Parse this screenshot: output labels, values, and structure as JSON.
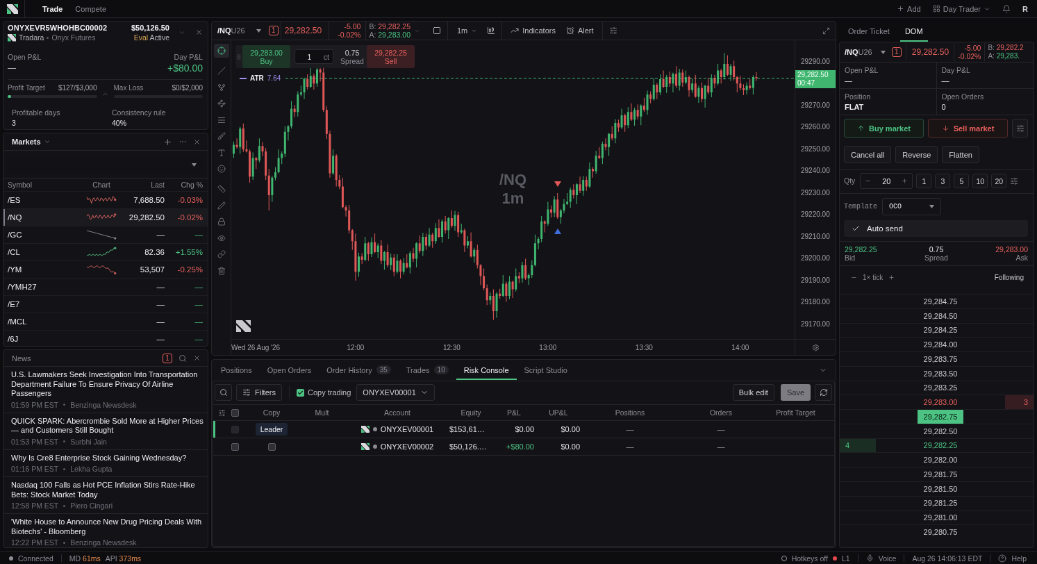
{
  "top_bar": {
    "nav_tabs": [
      {
        "label": "Trade",
        "selected": true
      },
      {
        "label": "Compete",
        "selected": false
      }
    ],
    "add_label": "Add",
    "layout_label": "Day Trader",
    "avatar": "R"
  },
  "account": {
    "id": "ONYXEVR5WHOHBC00002",
    "firm": "Tradara",
    "provider": "Onyx Futures",
    "balance": "$50,126.50",
    "stage": "Eval",
    "status": "Active",
    "open_pnl": {
      "label": "Open P&L",
      "value": "—"
    },
    "day_pnl": {
      "label": "Day P&L",
      "value": "+$80.00",
      "gain": true
    },
    "rules": [
      {
        "label": "Profit Target",
        "value": "$127/$3,000",
        "level": 0.04
      },
      {
        "label": "Max Loss",
        "value": "$0/$2,000"
      }
    ],
    "stats": [
      {
        "label": "Profitable days",
        "value": "3"
      },
      {
        "label": "Consistency rule",
        "value": "40%"
      }
    ]
  },
  "markets": {
    "title": "Markets",
    "columns": [
      "Symbol",
      "Chart",
      "Last",
      "Chg %"
    ],
    "rows": [
      {
        "symbol": "/ES",
        "kind": "choppy",
        "last": "7,688.50",
        "change": "-0.03%",
        "negative": true,
        "selected": false
      },
      {
        "symbol": "/NQ",
        "kind": "choppy",
        "last": "29,282.50",
        "change": "-0.02%",
        "negative": true,
        "selected": true
      },
      {
        "symbol": "/GC",
        "kind": "line",
        "last": "—",
        "change": "—",
        "negative": false,
        "selected": false
      },
      {
        "symbol": "/CL",
        "kind": "rising",
        "last": "82.36",
        "change": "+1.55%",
        "negative": false,
        "selected": false
      },
      {
        "symbol": "/YM",
        "kind": "dropping",
        "last": "53,507",
        "change": "-0.25%",
        "negative": true,
        "selected": false
      },
      {
        "symbol": "/YMH27",
        "kind": "plain",
        "last": "—",
        "change": "—",
        "negative": false,
        "selected": false
      },
      {
        "symbol": "/E7",
        "kind": "plain",
        "last": "—",
        "change": "—",
        "negative": false,
        "selected": false
      },
      {
        "symbol": "/MCL",
        "kind": "plain",
        "last": "—",
        "change": "—",
        "negative": false,
        "selected": false
      },
      {
        "symbol": "/6J",
        "kind": "plain",
        "last": "—",
        "change": "—",
        "negative": false,
        "selected": false
      }
    ]
  },
  "news": {
    "title": "News",
    "badge": "1",
    "items": [
      {
        "headline": "U.S. Lawmakers Seek Investigation Into Transportation Department Failure To Ensure Privacy Of Airline Passengers",
        "time": "01:59 PM EST",
        "source": "Benzinga Newsdesk"
      },
      {
        "headline": "QUICK SPARK: Abercrombie Sold More at Higher Prices — and Customers Still Bought",
        "time": "01:53 PM EST",
        "source": "Surbhi Jain"
      },
      {
        "headline": "Why Is Cre8 Enterprise Stock Gaining Wednesday?",
        "time": "01:16 PM EST",
        "source": "Lekha Gupta"
      },
      {
        "headline": "Nasdaq 100 Falls as Hot PCE Inflation Stirs Rate-Hike Bets: Stock Market Today",
        "time": "12:58 PM EST",
        "source": "Piero Cingari"
      },
      {
        "headline": "'White House to Announce New Drug Pricing Deals With Biotechs' - Bloomberg",
        "time": "12:22 PM EST",
        "source": "Benzinga Newsdesk"
      }
    ]
  },
  "chart": {
    "symbol": "/NQ",
    "contract": "U26",
    "position_badge": "1",
    "price": "29,282.50",
    "change": "-5.00",
    "change_pct": "-0.02%",
    "negative": true,
    "bid_label": "B:",
    "bid": "29,282.25",
    "ask_label": "A:",
    "ask": "29,283.00",
    "interval": "1m",
    "indicators_label": "Indicators",
    "alert_label": "Alert",
    "drawing_tools": [
      [
        {
          "kind": "crosshair",
          "selected": true
        }
      ],
      [
        {
          "kind": "line",
          "selected": false
        },
        {
          "kind": "fork",
          "selected": false
        },
        {
          "kind": "pattern",
          "selected": false
        },
        {
          "kind": "levels",
          "selected": false
        },
        {
          "kind": "brush",
          "selected": false
        },
        {
          "kind": "text",
          "selected": false
        },
        {
          "kind": "emoji",
          "selected": false
        }
      ],
      [
        {
          "kind": "measure",
          "selected": false
        },
        {
          "kind": "pencil",
          "selected": false
        },
        {
          "kind": "lock",
          "selected": false
        },
        {
          "kind": "visibility",
          "selected": false
        },
        {
          "kind": "link",
          "selected": false
        },
        {
          "kind": "delete",
          "selected": false
        }
      ]
    ],
    "quick_trade": {
      "buy_price": "29,283.00",
      "buy_label": "Buy",
      "quantity": "1",
      "unit": "ct",
      "spread": "0.75",
      "spread_label": "Spread",
      "sell_price": "29,282.25",
      "sell_label": "Sell"
    },
    "indicator": {
      "name": "ATR",
      "value": "7.64"
    },
    "watermark": {
      "symbol": "/NQ",
      "interval": "1m"
    },
    "last_price": {
      "price": "29,282.50",
      "countdown": "00:47"
    },
    "date_label": "Wed 26 Aug '26",
    "chart_data": {
      "type": "candlestick",
      "xlim": [
        681.25,
        869.7
      ],
      "ylim": [
        29163.3,
        29299.8
      ],
      "xticks": [
        {
          "value": 720,
          "label": "12:00"
        },
        {
          "value": 750,
          "label": "12:30"
        },
        {
          "value": 780,
          "label": "13:00"
        },
        {
          "value": 810,
          "label": "13:30"
        },
        {
          "value": 840,
          "label": "14:00"
        }
      ],
      "yticks": [
        {
          "value": 29290,
          "label": "29290.00"
        },
        {
          "value": 29270,
          "label": "29270.00"
        },
        {
          "value": 29260,
          "label": "29260.00"
        },
        {
          "value": 29250,
          "label": "29250.00"
        },
        {
          "value": 29240,
          "label": "29240.00"
        },
        {
          "value": 29230,
          "label": "29230.00"
        },
        {
          "value": 29220,
          "label": "29220.00"
        },
        {
          "value": 29210,
          "label": "29210.00"
        },
        {
          "value": 29200,
          "label": "29200.00"
        },
        {
          "value": 29190,
          "label": "29190.00"
        },
        {
          "value": 29180,
          "label": "29180.00"
        },
        {
          "value": 29170,
          "label": "29170.00"
        }
      ],
      "ref_lines": [
        {
          "axis": "y",
          "value": 29282.5
        }
      ],
      "x": [
        682,
        683,
        684,
        685,
        686,
        687,
        688,
        689,
        690,
        691,
        692,
        693,
        694,
        695,
        696,
        697,
        698,
        699,
        700,
        701,
        702,
        703,
        704,
        705,
        706,
        707,
        708,
        709,
        710,
        711,
        712,
        713,
        714,
        715,
        716,
        717,
        718,
        719,
        720,
        721,
        722,
        723,
        724,
        725,
        726,
        727,
        728,
        729,
        730,
        731,
        732,
        733,
        734,
        735,
        736,
        737,
        738,
        739,
        740,
        741,
        742,
        743,
        744,
        745,
        746,
        747,
        748,
        749,
        750,
        751,
        752,
        753,
        754,
        755,
        756,
        757,
        758,
        759,
        760,
        761,
        762,
        763,
        764,
        765,
        766,
        767,
        768,
        769,
        770,
        771,
        772,
        773,
        774,
        775,
        776,
        777,
        778,
        779,
        780,
        781,
        782,
        783,
        784,
        785,
        786,
        787,
        788,
        789,
        790,
        791,
        792,
        793,
        794,
        795,
        796,
        797,
        798,
        799,
        800,
        801,
        802,
        803,
        804,
        805,
        806,
        807,
        808,
        809,
        810,
        811,
        812,
        813,
        814,
        815,
        816,
        817,
        818,
        819,
        820,
        821,
        822,
        823,
        824,
        825,
        826,
        827,
        828,
        829,
        830,
        831,
        832,
        833,
        834,
        835,
        836,
        837,
        838,
        839,
        840,
        841,
        842,
        843,
        844,
        845
      ],
      "ohlc": [
        [
          29248,
          29253.5,
          29246,
          29252
        ],
        [
          29252,
          29255,
          29250.25,
          29251
        ],
        [
          29251,
          29260.25,
          29248,
          29259.5
        ],
        [
          29259.5,
          29261.75,
          29248.75,
          29250
        ],
        [
          29250,
          29254,
          29248.5,
          29249
        ],
        [
          29249,
          29250,
          29234.75,
          29237.5
        ],
        [
          29237.5,
          29248.5,
          29236,
          29246
        ],
        [
          29246,
          29246.5,
          29241,
          29245
        ],
        [
          29245,
          29255,
          29244,
          29251.5
        ],
        [
          29251.5,
          29253.25,
          29246.75,
          29249
        ],
        [
          29249,
          29250.5,
          29236,
          29238
        ],
        [
          29238,
          29241,
          29222,
          29229
        ],
        [
          29229,
          29237.75,
          29226,
          29237
        ],
        [
          29237,
          29241.75,
          29235.75,
          29239.5
        ],
        [
          29239.5,
          29250,
          29239,
          29246
        ],
        [
          29246,
          29249,
          29243.25,
          29248
        ],
        [
          29248,
          29260.5,
          29246.5,
          29258
        ],
        [
          29258,
          29261,
          29254,
          29260.5
        ],
        [
          29260.5,
          29272,
          29259.5,
          29268.5
        ],
        [
          29268.5,
          29270.25,
          29264.75,
          29267
        ],
        [
          29267,
          29276.5,
          29265,
          29275
        ],
        [
          29275,
          29279,
          29274.25,
          29276
        ],
        [
          29276,
          29282.75,
          29273,
          29282
        ],
        [
          29282,
          29284.25,
          29277.25,
          29278.5
        ],
        [
          29278.5,
          29287.25,
          29278,
          29283.5
        ],
        [
          29283.5,
          29284.5,
          29277.25,
          29280
        ],
        [
          29280,
          29287.25,
          29278.5,
          29286.5
        ],
        [
          29286.5,
          29287,
          29281,
          29285
        ],
        [
          29285,
          29287.25,
          29267,
          29268
        ],
        [
          29268,
          29269.75,
          29254.75,
          29257
        ],
        [
          29257,
          29258.5,
          29237,
          29239
        ],
        [
          29239,
          29250,
          29238.25,
          29247
        ],
        [
          29247,
          29247.75,
          29233,
          29236
        ],
        [
          29236,
          29238.25,
          29231.75,
          29233
        ],
        [
          29233,
          29237,
          29223,
          29223.5
        ],
        [
          29223.5,
          29224.5,
          29219.25,
          29222
        ],
        [
          29222,
          29224.5,
          29211.5,
          29213
        ],
        [
          29213,
          29213.5,
          29204,
          29208
        ],
        [
          29208,
          29211.5,
          29190,
          29194
        ],
        [
          29194,
          29202.75,
          29191.75,
          29201
        ],
        [
          29201,
          29202.5,
          29197.5,
          29199.5
        ],
        [
          29199.5,
          29210,
          29198.75,
          29207
        ],
        [
          29207,
          29207.75,
          29199,
          29202
        ],
        [
          29202,
          29209.75,
          29200.75,
          29207.5
        ],
        [
          29207.5,
          29211.5,
          29202.5,
          29203
        ],
        [
          29203,
          29207,
          29200.25,
          29206
        ],
        [
          29206,
          29208.5,
          29197.5,
          29199
        ],
        [
          29199,
          29203.5,
          29195,
          29203
        ],
        [
          29203,
          29206.5,
          29196,
          29197
        ],
        [
          29197,
          29202.25,
          29194.75,
          29200.5
        ],
        [
          29200.5,
          29202,
          29192,
          29194
        ],
        [
          29194,
          29202,
          29193.25,
          29199
        ],
        [
          29199,
          29199.75,
          29191,
          29194
        ],
        [
          29194,
          29200.25,
          29192.75,
          29198
        ],
        [
          29198,
          29202,
          29195.5,
          29196
        ],
        [
          29196,
          29203.5,
          29193.25,
          29202.5
        ],
        [
          29202.5,
          29205,
          29198.5,
          29200
        ],
        [
          29200,
          29207.5,
          29196,
          29207
        ],
        [
          29207,
          29210.5,
          29202.5,
          29203.5
        ],
        [
          29203.5,
          29211.75,
          29201.25,
          29210
        ],
        [
          29210,
          29211.5,
          29204,
          29206
        ],
        [
          29206,
          29214,
          29205.25,
          29211
        ],
        [
          29211,
          29211.75,
          29205,
          29208
        ],
        [
          29208,
          29216.25,
          29206.75,
          29214
        ],
        [
          29214,
          29218,
          29209.5,
          29210
        ],
        [
          29210,
          29218,
          29207.25,
          29217
        ],
        [
          29217,
          29219.5,
          29211.5,
          29213
        ],
        [
          29213,
          29219,
          29209,
          29218.5
        ],
        [
          29218.5,
          29222,
          29214,
          29215
        ],
        [
          29215,
          29221.75,
          29212.75,
          29220
        ],
        [
          29220,
          29221.5,
          29210,
          29212
        ],
        [
          29212,
          29216,
          29211.25,
          29213
        ],
        [
          29213,
          29213.75,
          29203,
          29206
        ],
        [
          29206,
          29210.25,
          29204.75,
          29208
        ],
        [
          29208,
          29212,
          29200.5,
          29201
        ],
        [
          29201,
          29205,
          29198.25,
          29204
        ],
        [
          29204,
          29206.5,
          29195.5,
          29197
        ],
        [
          29197,
          29197.5,
          29188,
          29192
        ],
        [
          29192,
          29195.5,
          29185.5,
          29186.5
        ],
        [
          29186.5,
          29188.25,
          29178.75,
          29181
        ],
        [
          29181,
          29184.5,
          29179,
          29183
        ],
        [
          29183,
          29186,
          29172,
          29176
        ],
        [
          29176,
          29184.75,
          29173,
          29184
        ],
        [
          29184,
          29186.25,
          29181.75,
          29183
        ],
        [
          29183,
          29192.5,
          29182.5,
          29188.5
        ],
        [
          29188.5,
          29189.5,
          29180.25,
          29183
        ],
        [
          29183,
          29192,
          29181.5,
          29189.5
        ],
        [
          29189.5,
          29190,
          29182,
          29186
        ],
        [
          29186,
          29195.5,
          29185,
          29192
        ],
        [
          29192,
          29193.75,
          29188.75,
          29191
        ],
        [
          29191,
          29198.5,
          29189,
          29197
        ],
        [
          29197,
          29200,
          29190.25,
          29191
        ],
        [
          29191,
          29193.25,
          29188,
          29192.5
        ],
        [
          29192.5,
          29199.25,
          29191.25,
          29197
        ],
        [
          29197,
          29211,
          29196.5,
          29207
        ],
        [
          29207,
          29210,
          29204.25,
          29209
        ],
        [
          29209,
          29219.5,
          29207.5,
          29217
        ],
        [
          29217,
          29217.5,
          29212,
          29216
        ],
        [
          29216,
          29226,
          29215,
          29222.5
        ],
        [
          29222.5,
          29224.25,
          29218.75,
          29221
        ],
        [
          29221,
          29228.5,
          29219,
          29227
        ],
        [
          29227,
          29230,
          29218.25,
          29219
        ],
        [
          29219,
          29222.75,
          29216,
          29222
        ],
        [
          29222,
          29227.25,
          29220.75,
          29225
        ],
        [
          29225,
          29230,
          29224.5,
          29226
        ],
        [
          29226,
          29232.5,
          29223.25,
          29231.5
        ],
        [
          29231.5,
          29234,
          29227.5,
          29229
        ],
        [
          29229,
          29234.5,
          29225,
          29234
        ],
        [
          29234,
          29237.5,
          29230,
          29231
        ],
        [
          29231,
          29237.75,
          29228.75,
          29236
        ],
        [
          29236,
          29237.5,
          29231,
          29233
        ],
        [
          29233,
          29244,
          29232.25,
          29241
        ],
        [
          29241,
          29241.75,
          29237,
          29240
        ],
        [
          29240,
          29249.25,
          29238.75,
          29247
        ],
        [
          29247,
          29251,
          29245.5,
          29246
        ],
        [
          29246,
          29253.5,
          29243.25,
          29252.5
        ],
        [
          29252.5,
          29255,
          29249.5,
          29251
        ],
        [
          29251,
          29257.5,
          29247,
          29257
        ],
        [
          29257,
          29260.5,
          29254,
          29255
        ],
        [
          29255,
          29263.75,
          29252.75,
          29262
        ],
        [
          29262,
          29263.5,
          29258,
          29260
        ],
        [
          29260,
          29268.5,
          29259.25,
          29265.5
        ],
        [
          29265.5,
          29266.25,
          29258,
          29261
        ],
        [
          29261,
          29269.25,
          29259.75,
          29267
        ],
        [
          29267,
          29271,
          29263,
          29263.5
        ],
        [
          29263.5,
          29269,
          29260.75,
          29268
        ],
        [
          29268,
          29270.5,
          29263.5,
          29265
        ],
        [
          29265,
          29270.5,
          29261,
          29270
        ],
        [
          29270,
          29273.5,
          29267,
          29268
        ],
        [
          29268,
          29276.75,
          29265.75,
          29275
        ],
        [
          29275,
          29276.5,
          29271,
          29273
        ],
        [
          29273,
          29282.5,
          29272.25,
          29279.5
        ],
        [
          29279.5,
          29280.25,
          29273,
          29276
        ],
        [
          29276,
          29284.25,
          29274.75,
          29282
        ],
        [
          29282,
          29286,
          29278,
          29278.5
        ],
        [
          29278.5,
          29284,
          29275.75,
          29283
        ],
        [
          29283,
          29285.5,
          29278.5,
          29280
        ],
        [
          29280,
          29285,
          29276,
          29284.5
        ],
        [
          29284.5,
          29288,
          29278,
          29279
        ],
        [
          29279,
          29286.75,
          29276.75,
          29285
        ],
        [
          29285,
          29286.5,
          29278.5,
          29280.5
        ],
        [
          29280.5,
          29286,
          29279.75,
          29283
        ],
        [
          29283,
          29283.75,
          29274,
          29277
        ],
        [
          29277,
          29282.25,
          29275.75,
          29280
        ],
        [
          29280,
          29284,
          29273.5,
          29274
        ],
        [
          29274,
          29279,
          29271.25,
          29278
        ],
        [
          29278,
          29280.5,
          29271.5,
          29273
        ],
        [
          29273,
          29279.5,
          29269,
          29279
        ],
        [
          29279,
          29282.5,
          29275,
          29276
        ],
        [
          29276,
          29284.25,
          29273.75,
          29282.5
        ],
        [
          29282.5,
          29284,
          29278,
          29280
        ],
        [
          29280,
          29289,
          29279.25,
          29286
        ],
        [
          29286,
          29286.75,
          29280,
          29283
        ],
        [
          29283,
          29294,
          29281.75,
          29289
        ],
        [
          29289,
          29293,
          29283.5,
          29284
        ],
        [
          29284,
          29289,
          29281.25,
          29288
        ],
        [
          29288,
          29290.5,
          29281.5,
          29283
        ],
        [
          29283,
          29283.5,
          29276,
          29280
        ],
        [
          29280,
          29283.5,
          29277,
          29278
        ],
        [
          29278,
          29279.75,
          29274.75,
          29277
        ],
        [
          29277,
          29280.5,
          29275,
          29279
        ],
        [
          29279,
          29282,
          29277.25,
          29278
        ],
        [
          29278,
          29283.75,
          29275,
          29283
        ],
        [
          29283,
          29285.25,
          29281.25,
          29282.5
        ]
      ]
    }
  },
  "bottom": {
    "tabs": [
      {
        "label": "Positions",
        "selected": false
      },
      {
        "label": "Open Orders",
        "selected": false
      },
      {
        "label": "Order History",
        "count": "35",
        "selected": false
      },
      {
        "label": "Trades",
        "count": "10",
        "selected": false
      },
      {
        "label": "Risk Console",
        "selected": true
      },
      {
        "label": "Script Studio",
        "selected": false
      }
    ],
    "filters_label": "Filters",
    "copy_trading": {
      "label": "Copy trading",
      "checked": true
    },
    "leader_account": "ONYXEV00001",
    "bulk_edit_label": "Bulk edit",
    "save": {
      "label": "Save",
      "disabled": true
    },
    "table": {
      "all_checked": false,
      "columns": [
        "Copy",
        "Mult",
        "Account",
        "Equity",
        "P&L",
        "UP&L",
        "Positions",
        "Orders",
        "Profit Target"
      ],
      "rows": [
        {
          "selected": true,
          "checked": false,
          "checkbox_disabled": true,
          "copy": {
            "kind": "leader",
            "label": "Leader"
          },
          "account": "ONYXEV00001",
          "equity": "$153,61…",
          "pnl": "$0.00",
          "pnl_gain": false,
          "upnl": "$0.00",
          "positions": "—",
          "orders": "—"
        },
        {
          "selected": false,
          "checked": false,
          "checkbox_disabled": false,
          "copy": {
            "kind": "follower",
            "checked": false
          },
          "account": "ONYXEV00002",
          "equity": "$50,126.…",
          "pnl": "+$80.00",
          "pnl_gain": true,
          "upnl": "$0.00",
          "positions": "—",
          "orders": "—"
        }
      ]
    }
  },
  "order_panel": {
    "tabs": [
      {
        "label": "Order Ticket",
        "selected": false
      },
      {
        "label": "DOM",
        "selected": true
      }
    ],
    "symbol": "/NQ",
    "contract": "U26",
    "position_badge": "1",
    "price": "29,282.50",
    "change": "-5.00",
    "change_pct": "-0.02%",
    "negative": true,
    "bid_label": "B:",
    "bid": "29,282.2",
    "ask_label": "A:",
    "ask": "29,283.",
    "stats": [
      {
        "label": "Open P&L",
        "value": "—"
      },
      {
        "label": "Day P&L",
        "value": "—"
      },
      {
        "label": "Position",
        "value": "FLAT"
      },
      {
        "label": "Open Orders",
        "value": "0"
      }
    ],
    "buy_market_label": "Buy market",
    "sell_market_label": "Sell market",
    "actions": [
      "Cancel all",
      "Reverse",
      "Flatten"
    ],
    "quantity": {
      "label": "Qty",
      "value": "20",
      "presets": [
        "1",
        "3",
        "5",
        "10",
        "20"
      ]
    },
    "template": {
      "label": "Template",
      "value": "OCO"
    },
    "auto_send": {
      "label": "Auto send",
      "checked": true
    },
    "quote": {
      "bid": "29,282.25",
      "bid_label": "Bid",
      "spread": "0.75",
      "spread_label": "Spread",
      "ask": "29,283.00",
      "ask_label": "Ask"
    },
    "tick_label": "1× tick",
    "follow_label": "Following",
    "ladder": [
      {
        "price": "29,284.75",
        "kind": "level"
      },
      {
        "price": "29,284.50",
        "kind": "level"
      },
      {
        "price": "29,284.25",
        "kind": "level"
      },
      {
        "price": "29,284.00",
        "kind": "level"
      },
      {
        "price": "29,283.75",
        "kind": "level"
      },
      {
        "price": "29,283.50",
        "kind": "level"
      },
      {
        "price": "29,283.25",
        "kind": "level"
      },
      {
        "price": "29,283.00",
        "kind": "ask",
        "ask_size": "3"
      },
      {
        "price": "29,282.75",
        "kind": "last"
      },
      {
        "price": "29,282.50",
        "kind": "level"
      },
      {
        "price": "29,282.25",
        "kind": "bid",
        "bid_size": "4"
      },
      {
        "price": "29,282.00",
        "kind": "level"
      },
      {
        "price": "29,281.75",
        "kind": "level"
      },
      {
        "price": "29,281.50",
        "kind": "level"
      },
      {
        "price": "29,281.25",
        "kind": "level"
      },
      {
        "price": "29,281.00",
        "kind": "level"
      },
      {
        "price": "29,280.75",
        "kind": "level"
      }
    ]
  },
  "status_bar": {
    "connection": {
      "label": "Connected",
      "color": "#8e8e95"
    },
    "latency": [
      {
        "label": "MD",
        "value": "61ms",
        "slow": true
      },
      {
        "label": "API",
        "value": "373ms",
        "slow": true
      }
    ],
    "hotkeys": {
      "label": "Hotkeys off",
      "on": false
    },
    "feed": {
      "label": "L1",
      "color": "#e5484d"
    },
    "voice_label": "Voice",
    "clock": "Aug 26 14:06:13 EDT",
    "help_label": "Help"
  }
}
